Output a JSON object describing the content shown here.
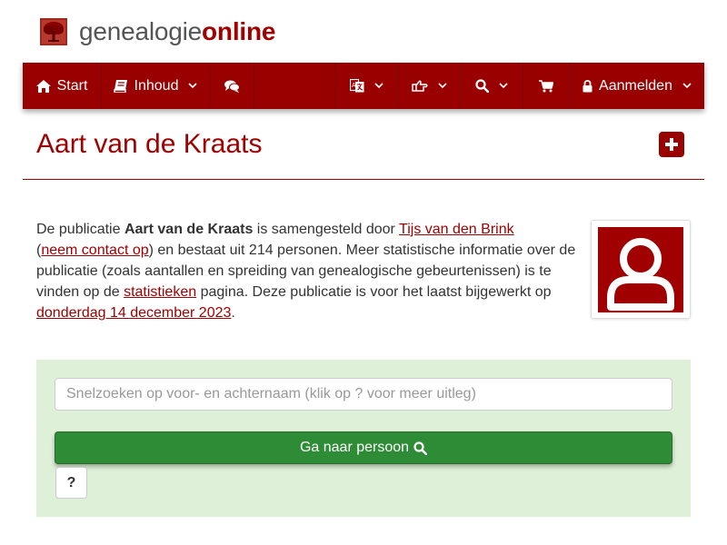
{
  "logo": {
    "text_part1": "genealogie",
    "text_part2": "online",
    "icon": "tree-icon"
  },
  "nav": {
    "start_label": "Start",
    "inhoud_label": "Inhoud",
    "login_label": "Aanmelden",
    "icons": [
      "home-icon",
      "book-icon",
      "comments-icon",
      "language-icon",
      "hand-point-icon",
      "search-icon",
      "cart-icon",
      "lock-icon"
    ]
  },
  "page": {
    "title": "Aart van de Kraats"
  },
  "description": {
    "part1": "De publicatie ",
    "name": "Aart van de Kraats",
    "part2": " is samengesteld door ",
    "author_link": "Tijs van den Brink",
    "part3": "(",
    "contact_link": "neem contact op",
    "part4": ") en bestaat uit 214 personen. Meer statistische informatie over de publicatie (zoals aantallen en spreiding van genealogische gebeurtenissen) is te vinden op de ",
    "stats_link": "statistieken",
    "part5": " pagina. Deze publicatie is voor het laatst bijgewerkt op ",
    "date_link": "donderdag 14 december 2023",
    "part6": "."
  },
  "search": {
    "placeholder": "Snelzoeken op voor- en achternaam (klik op ? voor meer uitleg)",
    "go_label": "Ga naar persoon",
    "help_label": "?"
  },
  "colors": {
    "brand": "#990000",
    "link": "#a00000",
    "panel_bg": "#dff0d8",
    "go_button": "#2e8b36"
  }
}
